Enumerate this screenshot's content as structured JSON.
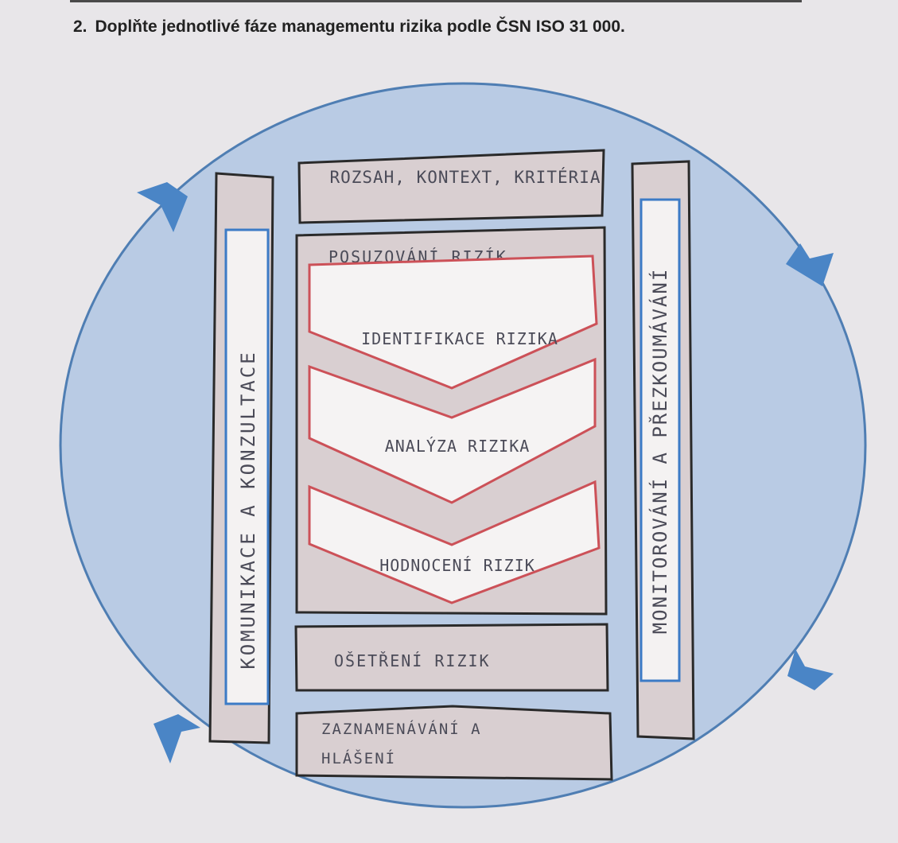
{
  "question": {
    "number": "2.",
    "text": "Doplňte jednotlivé fáze managementu rizika podle ČSN ISO 31 000."
  },
  "diagram": {
    "scope_box": "ROZSAH, KONTEXT, KRITÉRIA",
    "assessment_box": "POSUZOVÁNÍ RIZÍK",
    "steps": [
      "IDENTIFIKACE RIZIKA",
      "ANALÝZA RIZIKA",
      "HODNOCENÍ RIZIK"
    ],
    "treatment_box": "OŠETŘENÍ RIZIK",
    "recording_box_lines": [
      "ZAZNAMENÁVÁNÍ A",
      "HLÁŠENÍ"
    ],
    "left_bar": "KOMUNIKACE A KONZULTACE",
    "right_bar": "MONITOROVÁNÍ A PŘEZKOUMÁVÁNÍ"
  },
  "colors": {
    "background": "#e8e6e9",
    "circle_fill": "#b9cbe4",
    "circle_stroke": "#4f7eb3",
    "box_fill": "#d9cfd1",
    "chevron_fill": "#f5f3f3",
    "chevron_stroke": "#cc5158",
    "bar_inner_stroke": "#3c7bc6",
    "arrow": "#4a85c6",
    "handwriting": "#4b4b58"
  }
}
